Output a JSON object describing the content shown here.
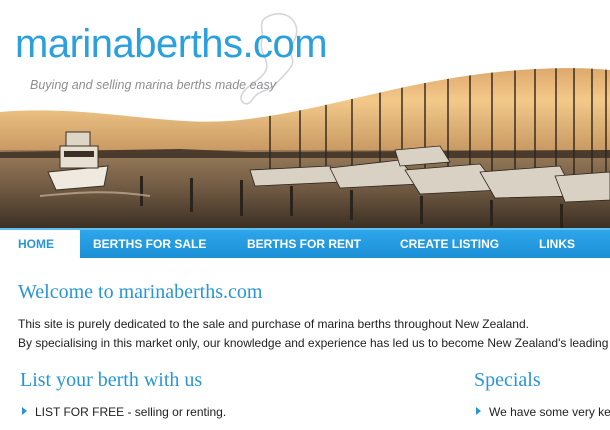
{
  "header": {
    "logo": "marinaberths.com",
    "tagline": "Buying and selling marina berths made easy"
  },
  "nav": {
    "items": [
      {
        "label": "HOME",
        "active": true
      },
      {
        "label": "BERTHS FOR SALE"
      },
      {
        "label": "BERTHS FOR RENT"
      },
      {
        "label": "CREATE LISTING"
      },
      {
        "label": "LINKS"
      }
    ]
  },
  "main": {
    "title": "Welcome to marinaberths.com",
    "para1": "This site is purely dedicated to the sale and purchase of marina berths throughout New Zealand.",
    "para2": "By specialising in this market only, our knowledge and experience has led us to become New Zealand's leading",
    "list_heading": "List your berth with us",
    "list_items": [
      "LIST FOR FREE - selling or renting."
    ],
    "specials_heading": "Specials",
    "specials_items": [
      "We have some very ke"
    ]
  },
  "colors": {
    "accent": "#2a95d6",
    "nav": "#1b8fd6"
  }
}
